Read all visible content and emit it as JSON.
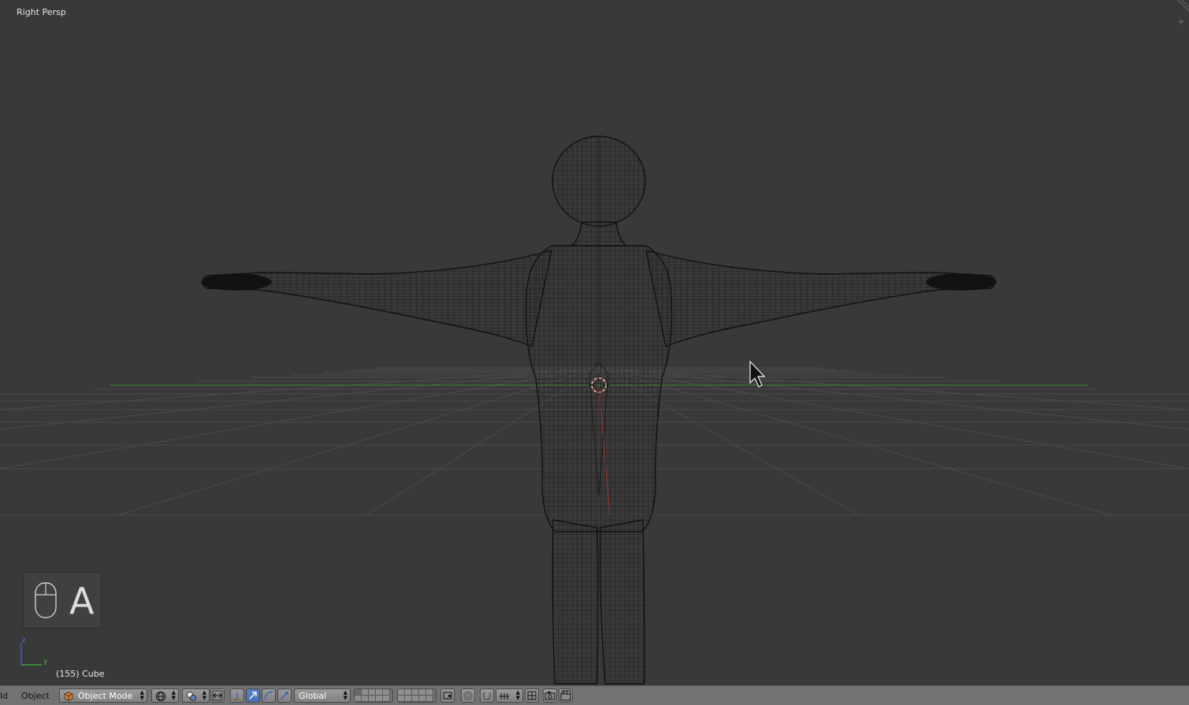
{
  "viewport": {
    "view_label": "Right Persp",
    "object_info": "(155) Cube",
    "key_overlay_letter": "A",
    "axes": {
      "z": "z",
      "y": "y"
    }
  },
  "header": {
    "menu_cut": "ld",
    "menu_object": "Object",
    "mode": {
      "label": "Object Mode"
    },
    "orientation": {
      "label": "Global"
    }
  },
  "colors": {
    "viewport_bg": "#393939",
    "grid_line": "#4a4a4a",
    "x_axis_red": "#b03030",
    "y_axis_green": "#3a8a2a",
    "header_bg": "#727272",
    "active_blue": "#5680c2"
  },
  "icons": {
    "mode_icon": "cube-icon",
    "shading_icon": "globe-icon",
    "pivot_icon": "pivot-icon",
    "manipulator_icon": "manipulator-axes-icon"
  }
}
